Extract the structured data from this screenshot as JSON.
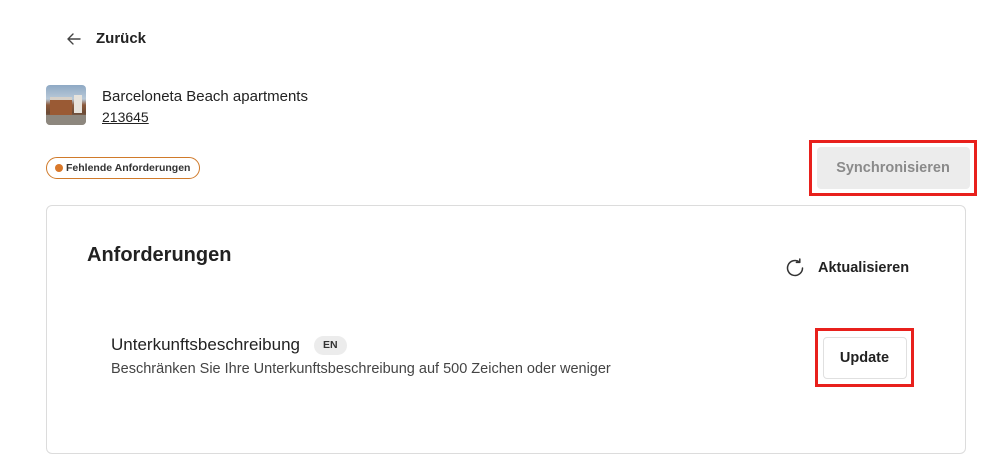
{
  "nav": {
    "back_label": "Zurück",
    "back_icon": "arrow-left-icon"
  },
  "property": {
    "name": "Barceloneta Beach apartments",
    "id": "213645",
    "thumbnail": "property-photo"
  },
  "status": {
    "badge_label": "Fehlende Anforderungen",
    "badge_color": "#d9782a"
  },
  "actions": {
    "sync_label": "Synchronisieren"
  },
  "requirements": {
    "title": "Anforderungen",
    "refresh_label": "Aktualisieren",
    "refresh_icon": "refresh-icon",
    "items": [
      {
        "title": "Unterkunftsbeschreibung",
        "lang": "EN",
        "description": "Beschränken Sie Ihre Unterkunftsbeschreibung auf 500 Zeichen oder weniger",
        "action_label": "Update"
      }
    ]
  },
  "colors": {
    "highlight": "#e8201c",
    "badge_border": "#d07a2a",
    "disabled_button_bg": "#ececec",
    "disabled_button_text": "#8a8a8a"
  }
}
